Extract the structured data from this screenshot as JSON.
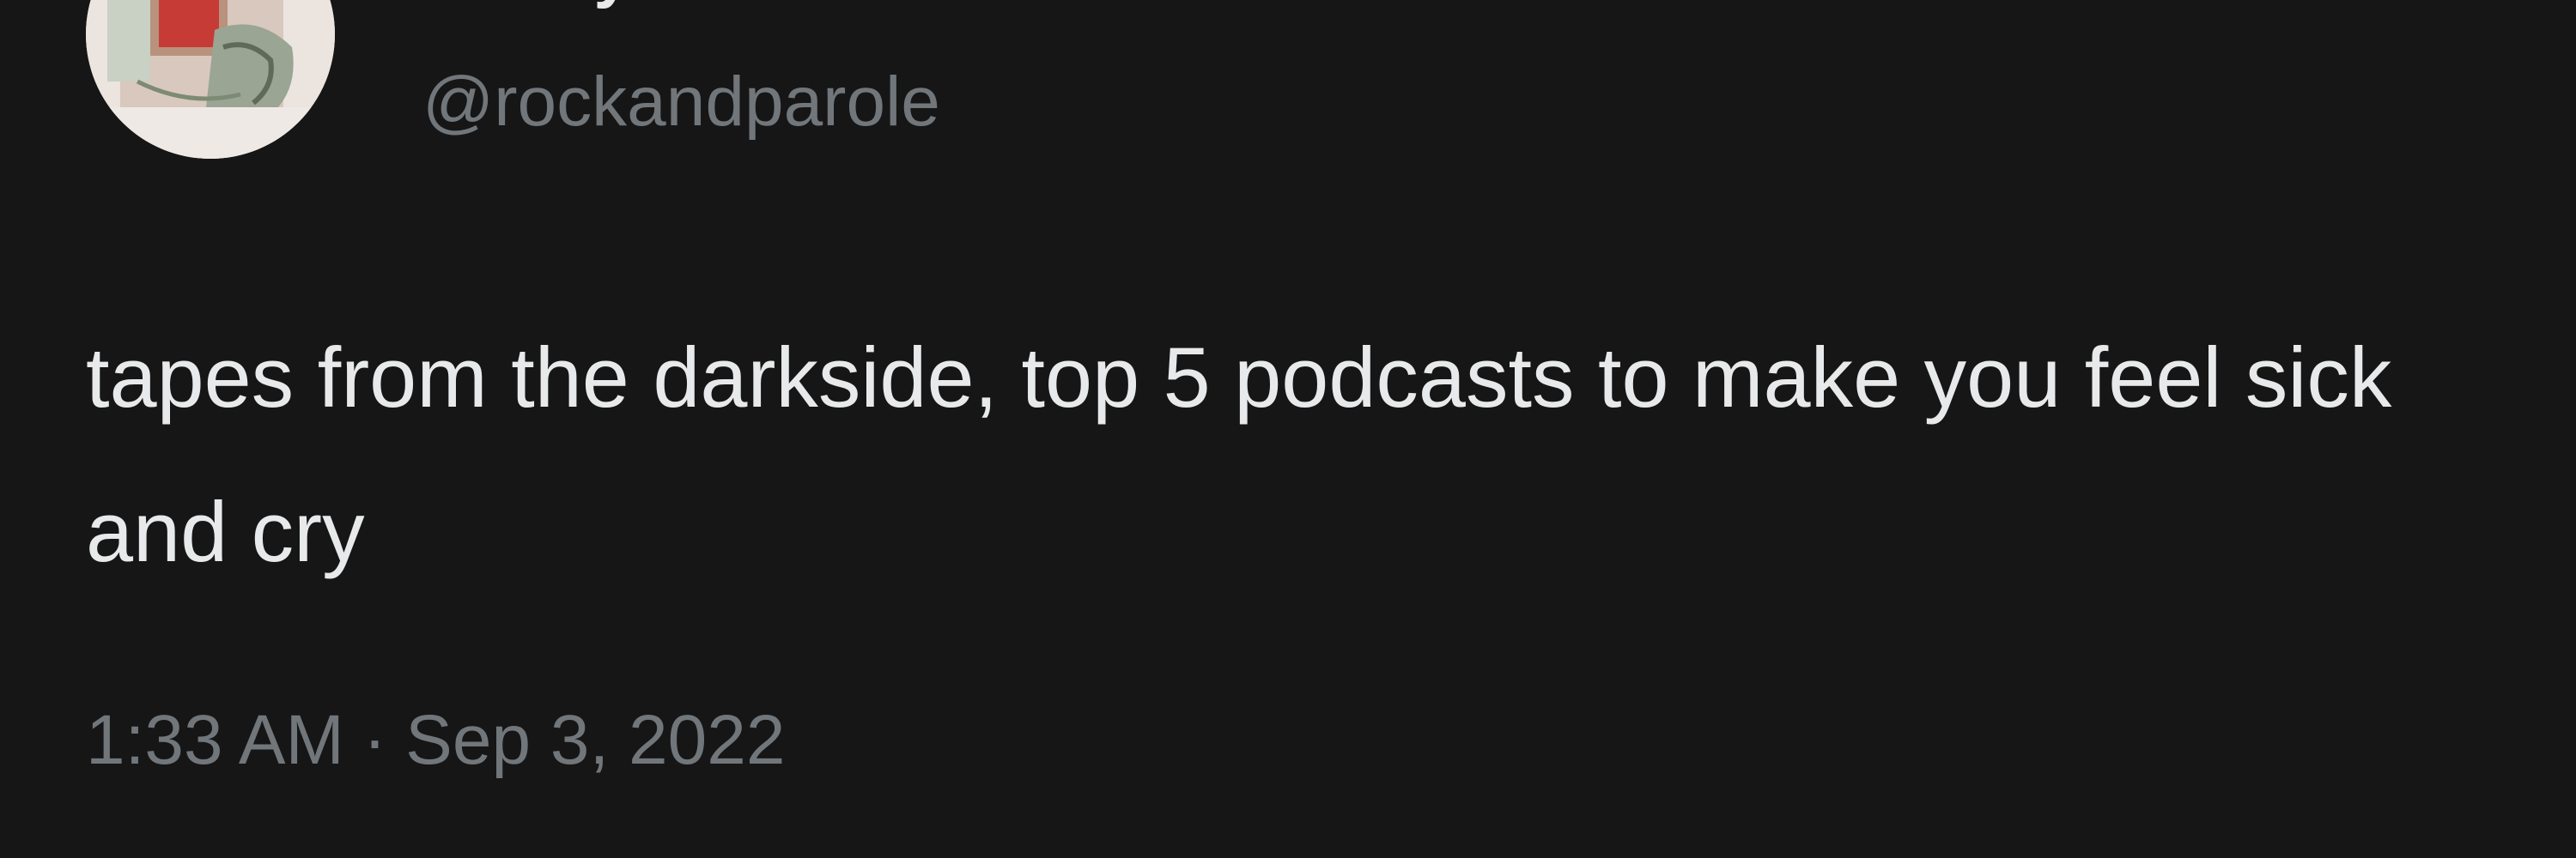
{
  "tweet": {
    "author": {
      "display_name": "ashley",
      "handle": "@rockandparole",
      "avatar_icon": "profile-photo"
    },
    "text": "tapes from the darkside, top 5 podcasts to make you feel sick and cry",
    "time": "1:33 AM",
    "separator": "·",
    "date": "Sep 3, 2022"
  },
  "colors": {
    "background": "#161616",
    "primary_text": "#e7e9ea",
    "secondary_text": "#71767b"
  }
}
